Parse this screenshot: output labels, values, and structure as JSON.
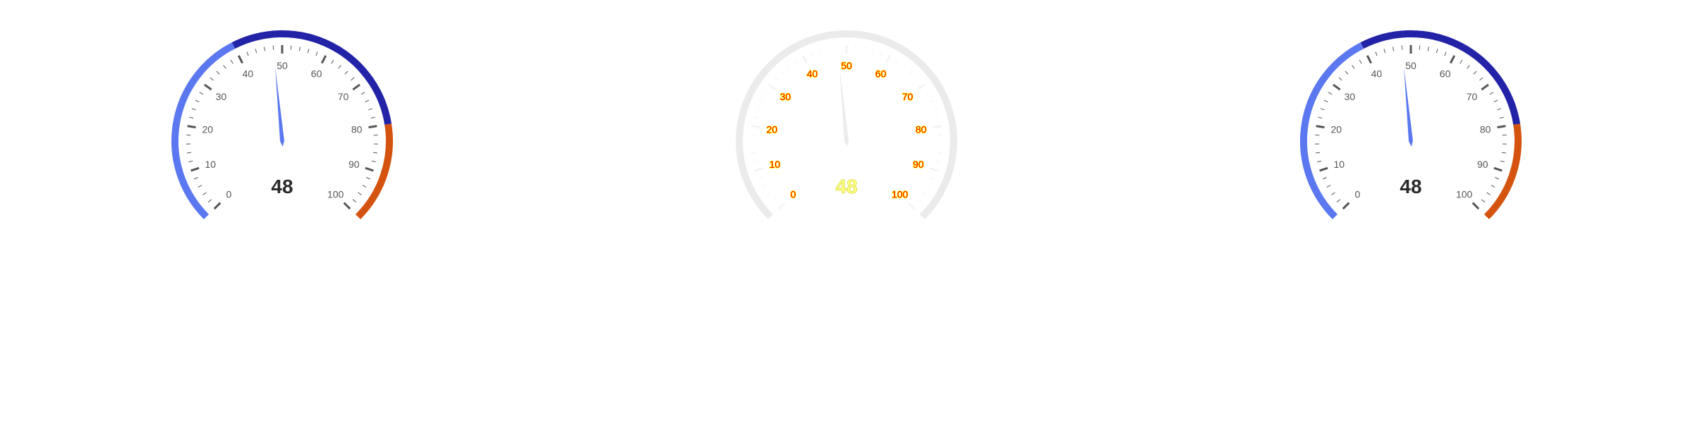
{
  "chart_data": [
    {
      "type": "gauge",
      "value": 48,
      "value_label": "48",
      "min": 0,
      "max": 100,
      "major_ticks": [
        0,
        10,
        20,
        30,
        40,
        50,
        60,
        70,
        80,
        90,
        100
      ],
      "tick_labels": [
        "0",
        "10",
        "20",
        "30",
        "40",
        "50",
        "60",
        "70",
        "80",
        "90",
        "100"
      ],
      "bands": [
        {
          "from": 0,
          "to": 40,
          "color": "#5b78f0"
        },
        {
          "from": 40,
          "to": 80,
          "color": "#2323a8"
        },
        {
          "from": 80,
          "to": 100,
          "color": "#d4530f"
        }
      ],
      "needle_color": "#5b78f0",
      "style": "normal"
    },
    {
      "type": "gauge",
      "value": 48,
      "value_label": "48",
      "min": 0,
      "max": 100,
      "major_ticks": [
        0,
        10,
        20,
        30,
        40,
        50,
        60,
        70,
        80,
        90,
        100
      ],
      "tick_labels": [
        "0",
        "10",
        "20",
        "30",
        "40",
        "50",
        "60",
        "70",
        "80",
        "90",
        "100"
      ],
      "bands": [
        {
          "from": 0,
          "to": 100,
          "color": "#ebebeb"
        }
      ],
      "needle_color": "#ebebeb",
      "style": "faded"
    },
    {
      "type": "gauge",
      "value": 48,
      "value_label": "48",
      "min": 0,
      "max": 100,
      "major_ticks": [
        0,
        10,
        20,
        30,
        40,
        50,
        60,
        70,
        80,
        90,
        100
      ],
      "tick_labels": [
        "0",
        "10",
        "20",
        "30",
        "40",
        "50",
        "60",
        "70",
        "80",
        "90",
        "100"
      ],
      "bands": [
        {
          "from": 0,
          "to": 40,
          "color": "#5b78f0"
        },
        {
          "from": 40,
          "to": 80,
          "color": "#2323a8"
        },
        {
          "from": 80,
          "to": 100,
          "color": "#d4530f"
        }
      ],
      "needle_color": "#5b78f0",
      "style": "normal"
    }
  ]
}
